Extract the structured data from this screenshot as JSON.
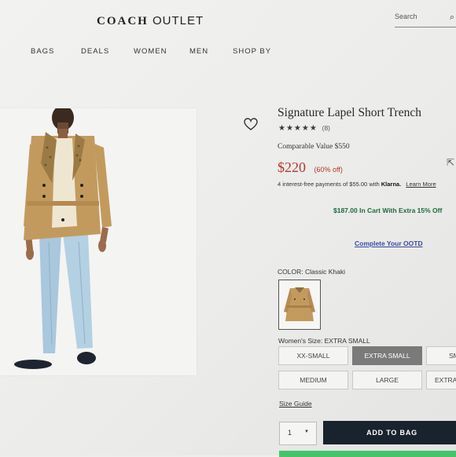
{
  "header": {
    "brand": "COACH",
    "outlet": "OUTLET",
    "search_placeholder": "Search"
  },
  "nav": [
    "BAGS",
    "DEALS",
    "WOMEN",
    "MEN",
    "SHOP BY"
  ],
  "product": {
    "title": "Signature Lapel Short Trench",
    "stars": "★★★★★",
    "rating": 4.5,
    "review_count": "(8)",
    "comparable_value": "Comparable Value  $550",
    "price": "$220",
    "discount": "(60% off)",
    "klarna_text": "4 interest-free payments of $55.00 with",
    "klarna_brand": "Klarna.",
    "learn_more": "Learn More",
    "in_cart": "$187.00 In Cart With Extra 15% Off",
    "ootd": "Complete Your OOTD",
    "color_label": "COLOR: Classic Khaki",
    "size_label": "Women's Size: EXTRA SMALL",
    "sizes": [
      "XX-SMALL",
      "EXTRA SMALL",
      "SMALL",
      "MEDIUM",
      "LARGE",
      "EXTRA LARGE"
    ],
    "selected_size": "EXTRA SMALL",
    "size_guide": "Size Guide",
    "quantity": "1",
    "add_to_bag": "ADD TO BAG"
  },
  "colors": {
    "price": "#b03a2e",
    "in_cart": "#1d6b3a",
    "link": "#3b4ba0",
    "add_to_bag_bg": "#18232d",
    "selected_size_bg": "#7a7a7a",
    "trench": "#c39a5e"
  }
}
